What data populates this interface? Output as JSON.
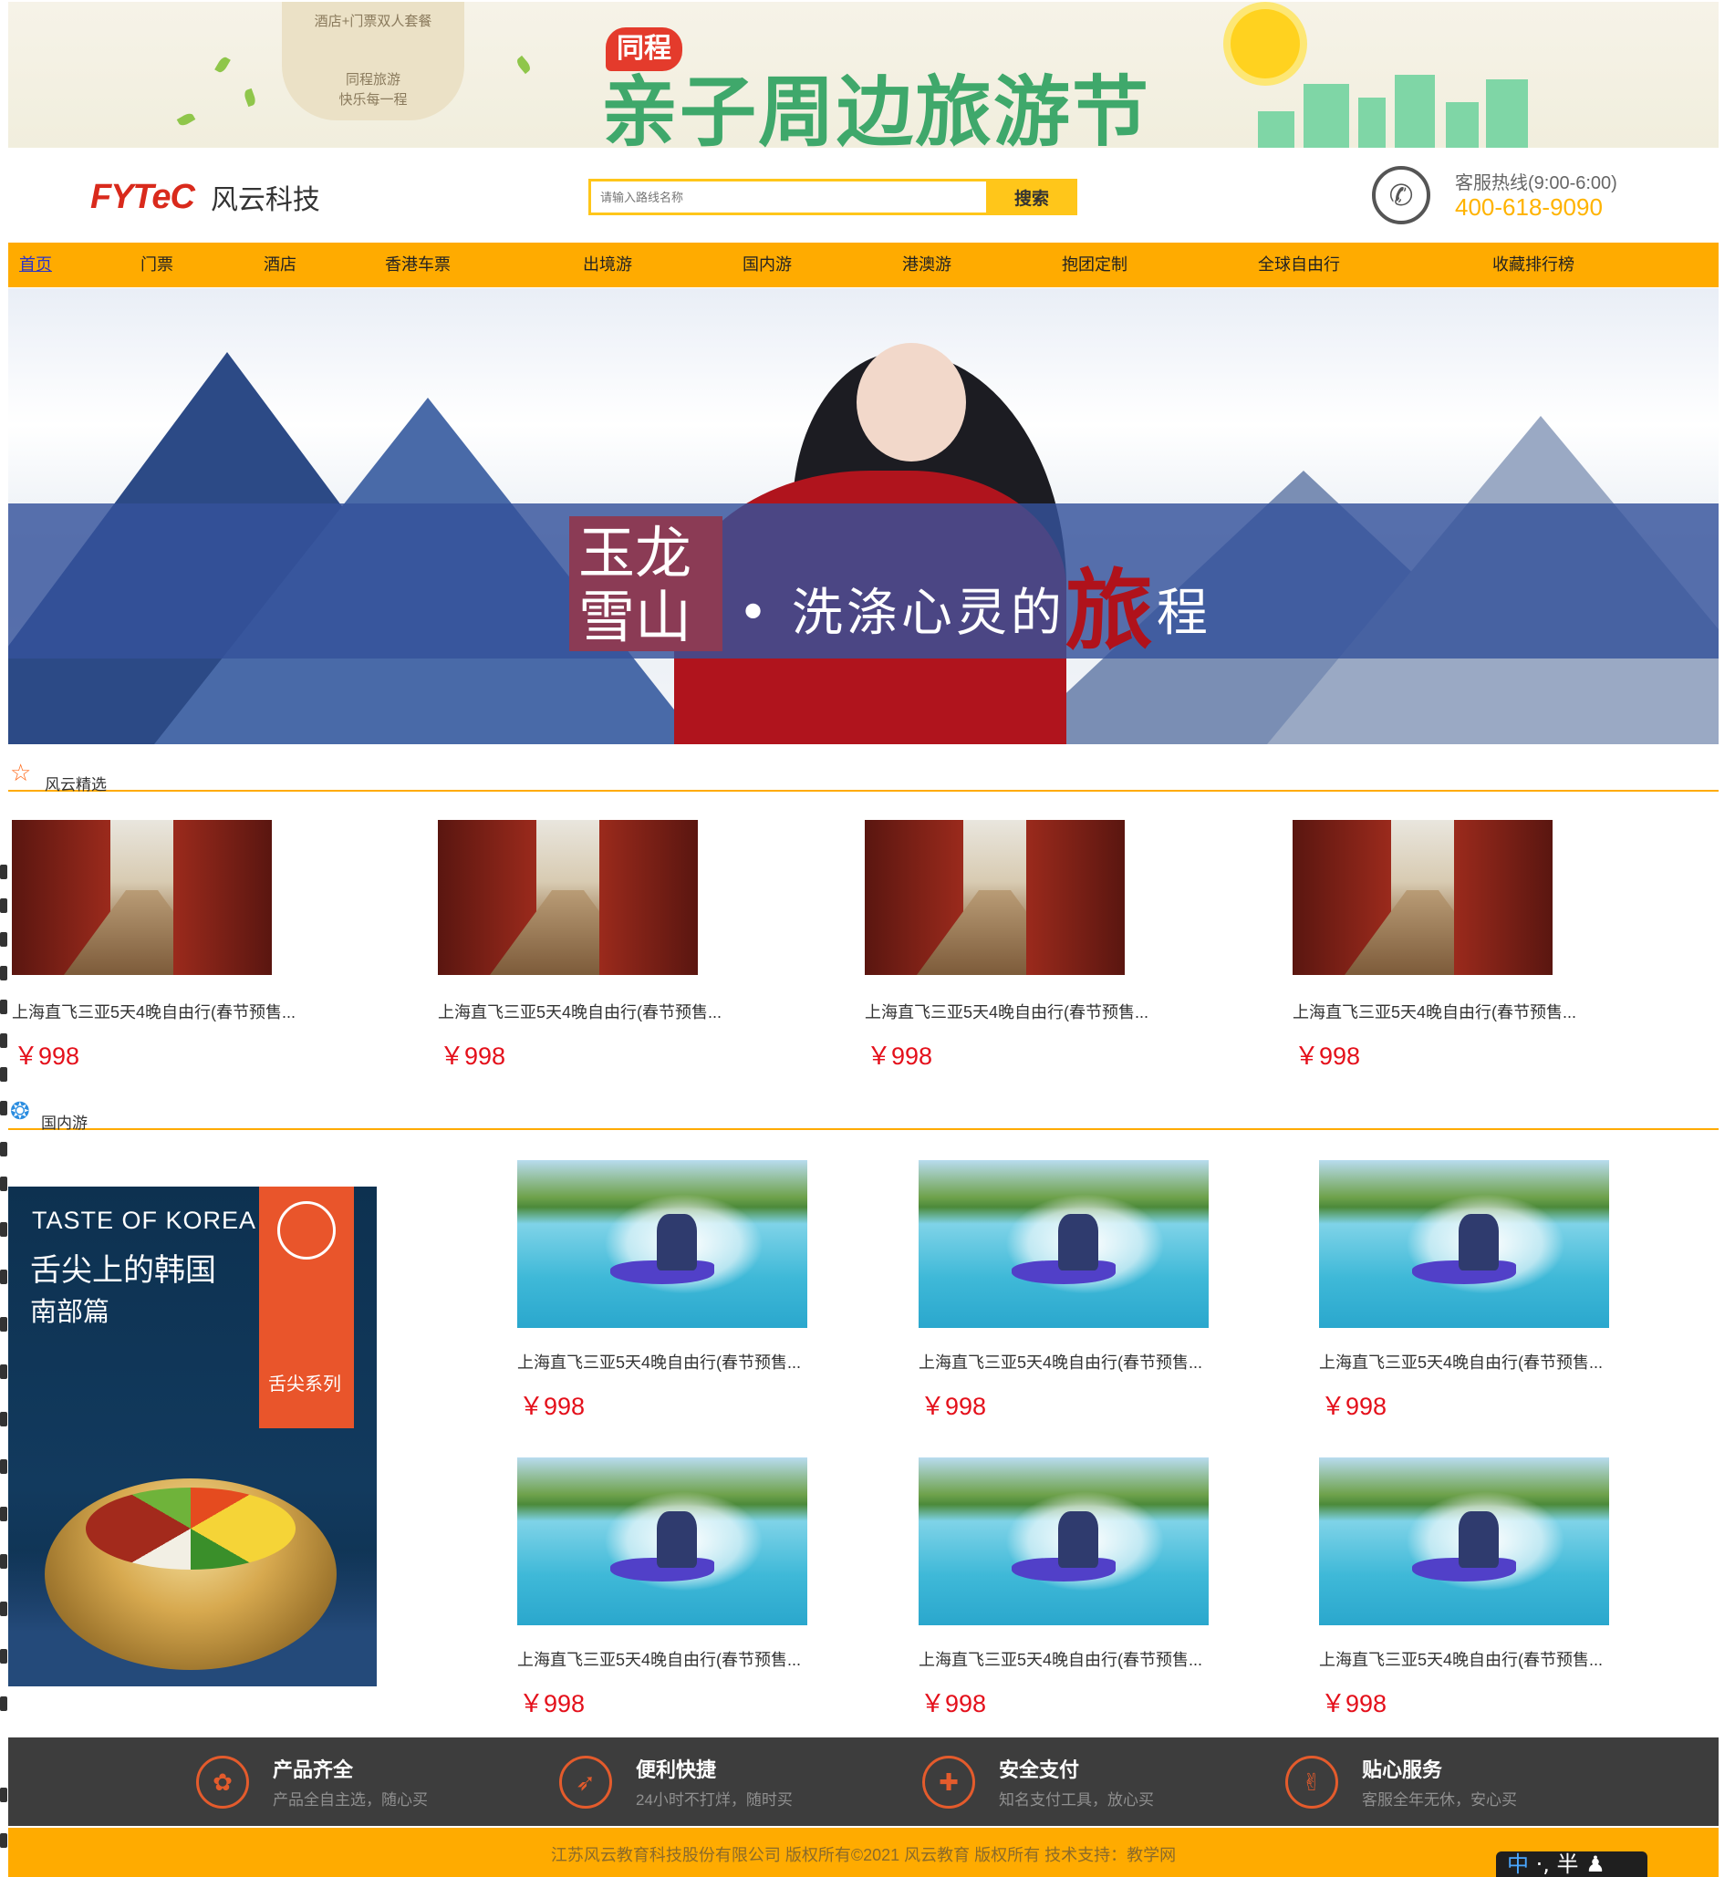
{
  "promo": {
    "card_line1": "酒店+门票双人套餐",
    "card_line2": "同程旅游",
    "card_line3": "快乐每一程",
    "brand_badge": "同程",
    "title": "亲子周边旅游节"
  },
  "header": {
    "logo_mark": "FYTeC",
    "logo_text": "风云科技",
    "search_placeholder": "请输入路线名称",
    "search_button": "搜索",
    "hotline_label": "客服热线(9:00-6:00)",
    "hotline_number": "400-618-9090"
  },
  "nav": {
    "items": [
      "首页",
      "门票",
      "酒店",
      "香港车票",
      "出境游",
      "国内游",
      "港澳游",
      "抱团定制",
      "全球自由行",
      "收藏排行榜"
    ],
    "active_index": 0
  },
  "hero": {
    "seal_line1": "玉龙",
    "seal_line2": "雪山",
    "slogan_prefix": "• 洗涤心灵的",
    "slogan_emphasis": "旅",
    "slogan_suffix": "程"
  },
  "featured": {
    "section_title": "风云精选",
    "icon": "star-outline-icon",
    "items": [
      {
        "name": "上海直飞三亚5天4晚自由行(春节预售...",
        "price": "￥998"
      },
      {
        "name": "上海直飞三亚5天4晚自由行(春节预售...",
        "price": "￥998"
      },
      {
        "name": "上海直飞三亚5天4晚自由行(春节预售...",
        "price": "￥998"
      },
      {
        "name": "上海直飞三亚5天4晚自由行(春节预售...",
        "price": "￥998"
      }
    ]
  },
  "domestic": {
    "section_title": "国内游",
    "icon": "ferris-wheel-icon",
    "poster": {
      "en_title": "TASTE OF KOREA",
      "cn_title": "舌尖上的韩国",
      "cn_subtitle": "南部篇",
      "series": "舌尖系列"
    },
    "items": [
      {
        "name": "上海直飞三亚5天4晚自由行(春节预售...",
        "price": "￥998"
      },
      {
        "name": "上海直飞三亚5天4晚自由行(春节预售...",
        "price": "￥998"
      },
      {
        "name": "上海直飞三亚5天4晚自由行(春节预售...",
        "price": "￥998"
      },
      {
        "name": "上海直飞三亚5天4晚自由行(春节预售...",
        "price": "￥998"
      },
      {
        "name": "上海直飞三亚5天4晚自由行(春节预售...",
        "price": "￥998"
      },
      {
        "name": "上海直飞三亚5天4晚自由行(春节预售...",
        "price": "￥998"
      }
    ]
  },
  "features": [
    {
      "title": "产品齐全",
      "subtitle": "产品全自主选，随心买",
      "icon": "grid-icon"
    },
    {
      "title": "便利快捷",
      "subtitle": "24小时不打烊，随时买",
      "icon": "rocket-icon"
    },
    {
      "title": "安全支付",
      "subtitle": "知名支付工具，放心买",
      "icon": "shield-icon"
    },
    {
      "title": "贴心服务",
      "subtitle": "客服全年无休，安心买",
      "icon": "thumbs-up-icon"
    }
  ],
  "footer": {
    "copyright": "江苏风云教育科技股份有限公司 版权所有©2021 风云教育 版权所有 技术支持：教学网"
  },
  "ime": {
    "mode": "中",
    "punct": "·,",
    "width": "半"
  },
  "colors": {
    "accent": "#ffab00",
    "price": "#e4101b",
    "nav_active": "#2a34c8",
    "footer_bar": "#3d3d3d"
  }
}
